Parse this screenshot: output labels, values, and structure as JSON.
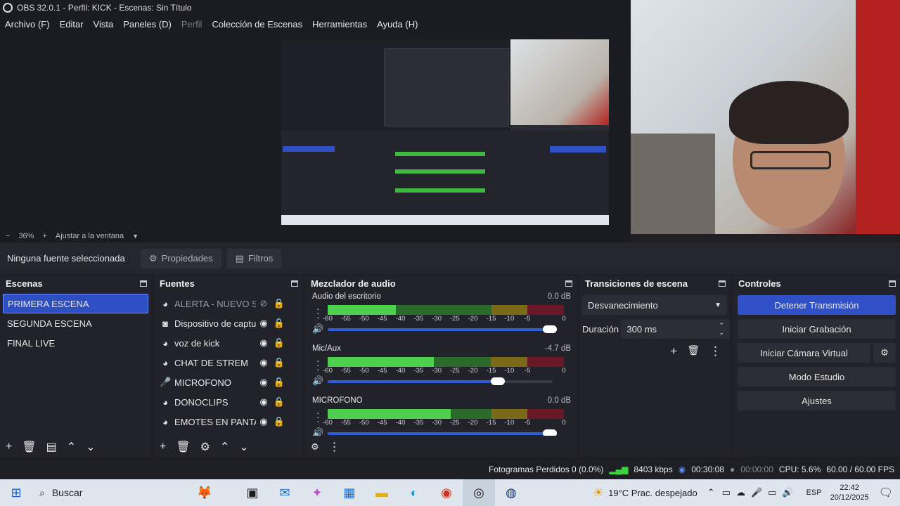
{
  "window": {
    "title": "OBS 32.0.1 - Perfil: KICK - Escenas: Sin Título"
  },
  "menu": [
    {
      "label": "Archivo (F)",
      "disabled": false
    },
    {
      "label": "Editar",
      "disabled": false
    },
    {
      "label": "Vista",
      "disabled": false
    },
    {
      "label": "Paneles (D)",
      "disabled": false
    },
    {
      "label": "Perfil",
      "disabled": true
    },
    {
      "label": "Colección de Escenas",
      "disabled": false
    },
    {
      "label": "Herramientas",
      "disabled": false
    },
    {
      "label": "Ayuda (H)",
      "disabled": false
    }
  ],
  "preview": {
    "zoom": "36%",
    "fit_label": "Ajustar a la ventana",
    "minus": "−",
    "plus": "+"
  },
  "source_toolbar": {
    "no_source": "Ninguna fuente seleccionada",
    "properties": "Propiedades",
    "filters": "Filtros"
  },
  "scenes": {
    "title": "Escenas",
    "items": [
      "PRIMERA ESCENA",
      "SEGUNDA ESCENA",
      "FINAL LIVE"
    ],
    "selected_index": 0
  },
  "sources": {
    "title": "Fuentes",
    "items": [
      {
        "name": "ALERTA - NUEVO SEG",
        "icon": "browser-icon",
        "visible": false
      },
      {
        "name": "Dispositivo de captu",
        "icon": "camera-icon",
        "visible": true
      },
      {
        "name": "voz de kick",
        "icon": "browser-icon",
        "visible": true
      },
      {
        "name": "CHAT DE STREM",
        "icon": "browser-icon",
        "visible": true
      },
      {
        "name": "MICROFONO",
        "icon": "mic-icon",
        "visible": true
      },
      {
        "name": "DONOCLIPS",
        "icon": "browser-icon",
        "visible": true
      },
      {
        "name": "EMOTES EN PANTALI",
        "icon": "browser-icon",
        "visible": true
      }
    ]
  },
  "mixer": {
    "title": "Mezclador de audio",
    "ticks": [
      "-60",
      "-55",
      "-50",
      "-45",
      "-40",
      "-35",
      "-30",
      "-25",
      "-20",
      "-15",
      "-10",
      "-5",
      "0"
    ],
    "channels": [
      {
        "name": "Audio del escritorio",
        "db": "0.0 dB",
        "level": 0.29,
        "volume": 1.0
      },
      {
        "name": "Mic/Aux",
        "db": "-4.7 dB",
        "level": 0.45,
        "volume": 0.77
      },
      {
        "name": "MICROFONO",
        "db": "0.0 dB",
        "level": 0.52,
        "volume": 1.0
      }
    ]
  },
  "transitions": {
    "title": "Transiciones de escena",
    "selected": "Desvanecimiento",
    "duration_label": "Duración",
    "duration_value": "300 ms"
  },
  "controls": {
    "title": "Controles",
    "stop_stream": "Detener Transmisión",
    "start_recording": "Iniciar Grabación",
    "virtual_cam": "Iniciar Cámara Virtual",
    "studio_mode": "Modo Estudio",
    "settings": "Ajustes"
  },
  "status": {
    "dropped_frames": "Fotogramas Perdidos 0 (0.0%)",
    "bitrate": "8403 kbps",
    "stream_time": "00:30:08",
    "rec_time": "00:00:00",
    "cpu": "CPU: 5.6%",
    "fps": "60.00 / 60.00 FPS"
  },
  "taskbar": {
    "search": "Buscar",
    "weather": "19°C  Prac. despejado",
    "lang": "ESP",
    "time": "22:42",
    "date": "20/12/2025"
  },
  "colors": {
    "accent": "#3050c8",
    "meter_green": "#4ed04e",
    "meter_yellow": "#c8b020",
    "meter_red": "#b02030"
  }
}
